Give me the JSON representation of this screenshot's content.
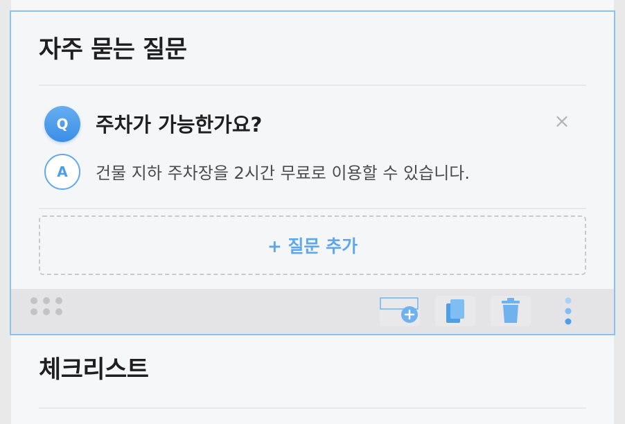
{
  "faq_block": {
    "title": "자주 묻는 질문",
    "items": [
      {
        "q_badge": "Q",
        "question": "주차가 가능한가요?",
        "a_badge": "A",
        "answer": "건물 지하 주차장을 2시간 무료로 이용할 수 있습니다.",
        "close_glyph": "×"
      }
    ],
    "add_button_label": "+ 질문 추가"
  },
  "toolbar": {
    "icons": [
      "drag-handle-icon",
      "add-block-icon",
      "copy-icon",
      "trash-icon",
      "more-vertical-icon"
    ]
  },
  "next_block": {
    "title": "체크리스트"
  },
  "colors": {
    "accent": "#4d9fe9",
    "selected_border": "#8cc1ec"
  }
}
